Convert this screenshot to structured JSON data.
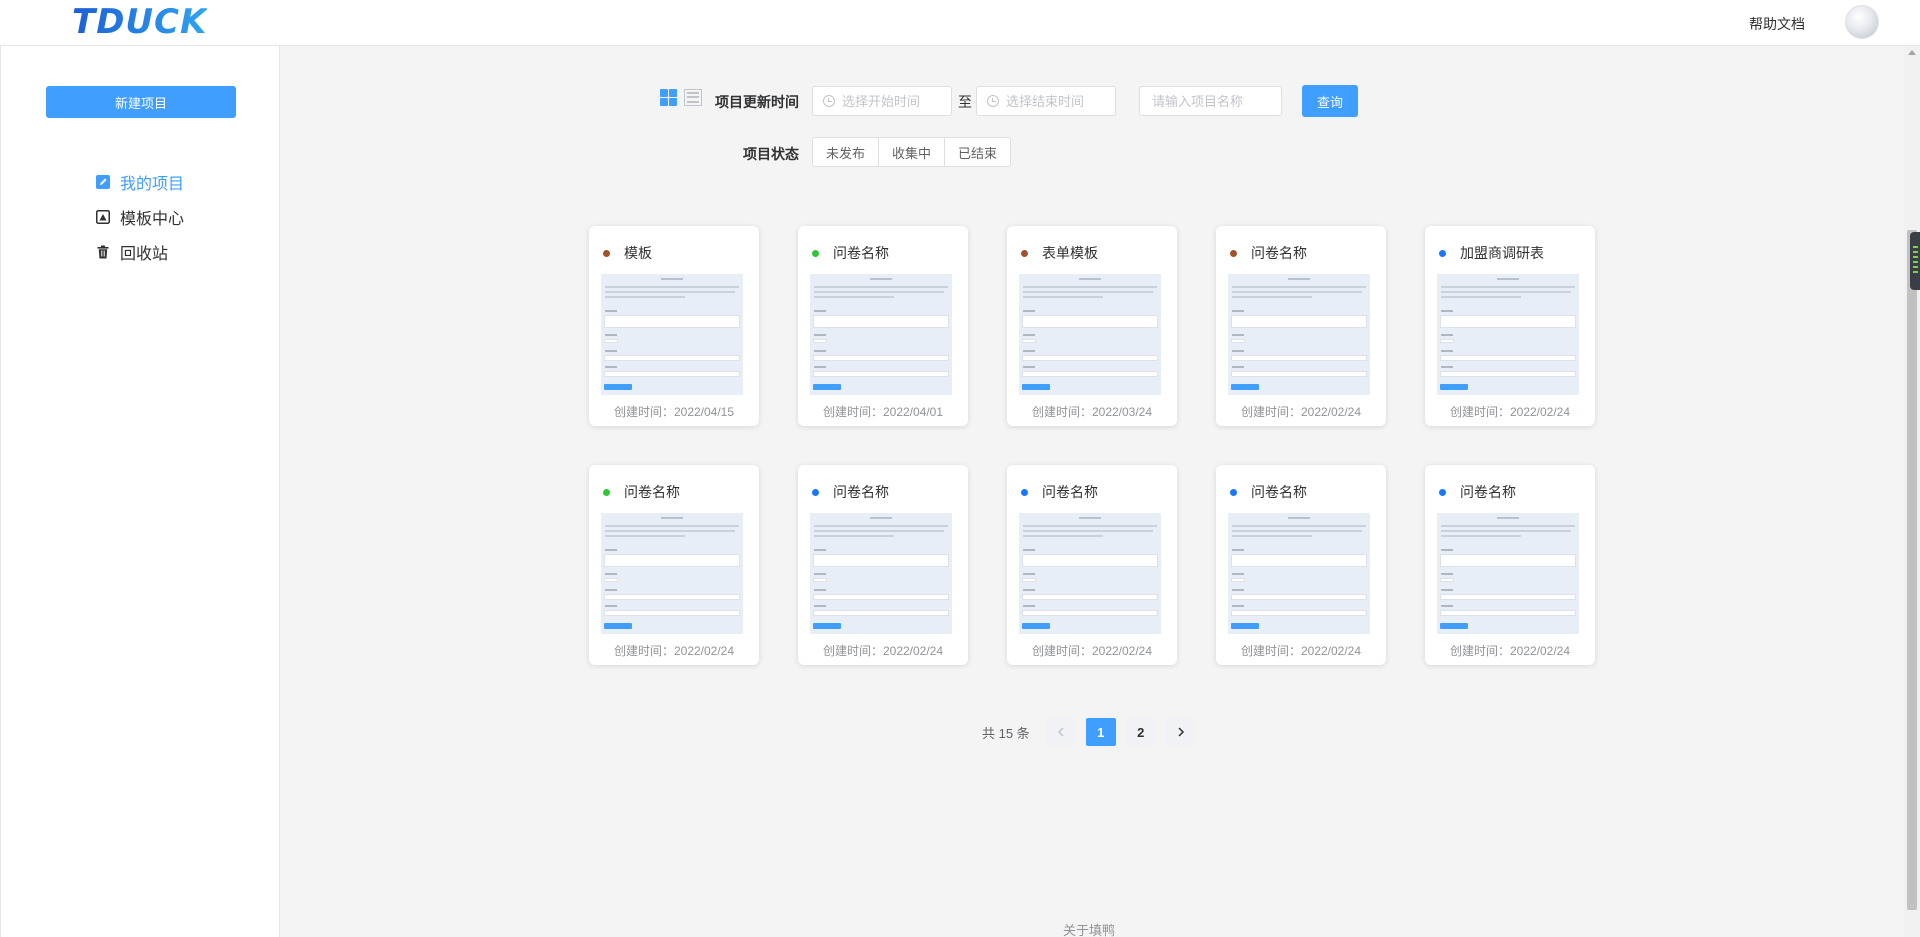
{
  "header": {
    "logo": "TDUCK",
    "help_link": "帮助文档",
    "avatar_icon": "user-avatar"
  },
  "sidebar": {
    "new_button": "新建项目",
    "items": [
      {
        "label": "我的项目",
        "icon": "edit-icon",
        "active": true
      },
      {
        "label": "模板中心",
        "icon": "template-icon",
        "active": false
      },
      {
        "label": "回收站",
        "icon": "trash-icon",
        "active": false
      }
    ]
  },
  "filters": {
    "update_time_label": "项目更新时间",
    "start_placeholder": "选择开始时间",
    "to_text": "至",
    "end_placeholder": "选择结束时间",
    "name_placeholder": "请输入项目名称",
    "query_button": "查询",
    "status_label": "项目状态",
    "status_options": [
      "未发布",
      "收集中",
      "已结束"
    ]
  },
  "colors": {
    "primary": "#409eff",
    "dot_brown": "#a0522d",
    "dot_green": "#2ec635",
    "dot_blue": "#1677ff"
  },
  "projects": [
    {
      "title": "模板",
      "date": "创建时间：2022/04/15",
      "dot": "#a0522d"
    },
    {
      "title": "问卷名称",
      "date": "创建时间：2022/04/01",
      "dot": "#2ec635"
    },
    {
      "title": "表单模板",
      "date": "创建时间：2022/03/24",
      "dot": "#a0522d"
    },
    {
      "title": "问卷名称",
      "date": "创建时间：2022/02/24",
      "dot": "#a0522d"
    },
    {
      "title": "加盟商调研表",
      "date": "创建时间：2022/02/24",
      "dot": "#1677ff"
    },
    {
      "title": "问卷名称",
      "date": "创建时间：2022/02/24",
      "dot": "#2ec635"
    },
    {
      "title": "问卷名称",
      "date": "创建时间：2022/02/24",
      "dot": "#1677ff"
    },
    {
      "title": "问卷名称",
      "date": "创建时间：2022/02/24",
      "dot": "#1677ff"
    },
    {
      "title": "问卷名称",
      "date": "创建时间：2022/02/24",
      "dot": "#1677ff"
    },
    {
      "title": "问卷名称",
      "date": "创建时间：2022/02/24",
      "dot": "#1677ff"
    }
  ],
  "pagination": {
    "total": "共 15 条",
    "pages": [
      "1",
      "2"
    ],
    "current": "1"
  },
  "footer": {
    "about_link": "关于填鸭"
  }
}
